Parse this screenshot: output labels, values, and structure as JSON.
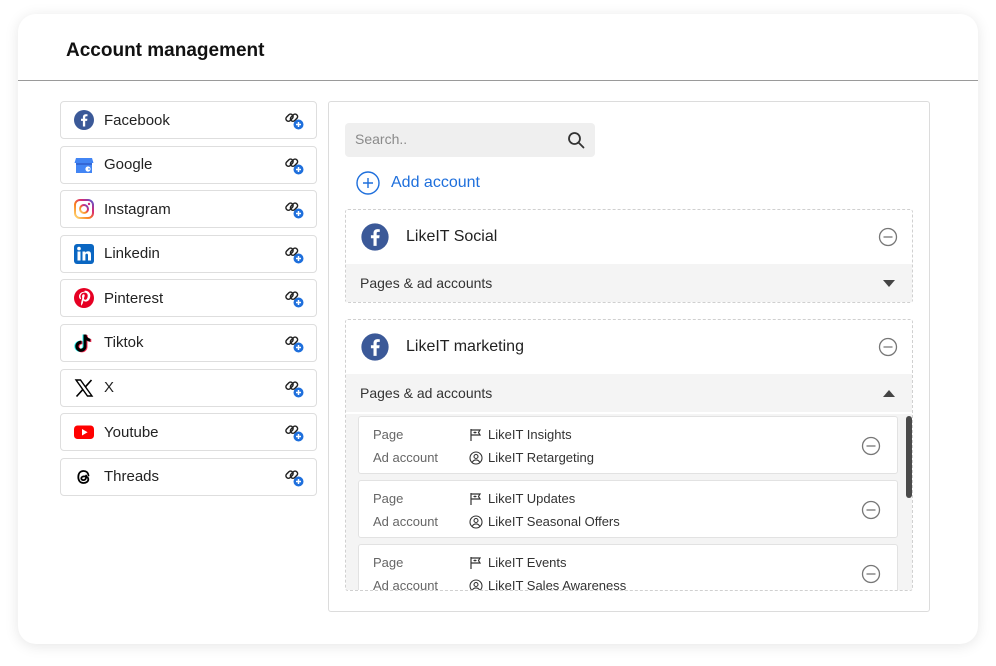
{
  "header": {
    "title": "Account management"
  },
  "platforms": [
    {
      "label": "Facebook",
      "icon": "facebook-icon",
      "color": "#3b5998"
    },
    {
      "label": "Google",
      "icon": "google-business-icon",
      "color": "#4285f4"
    },
    {
      "label": "Instagram",
      "icon": "instagram-icon",
      "color": "#e1306c"
    },
    {
      "label": "Linkedin",
      "icon": "linkedin-icon",
      "color": "#0a66c2"
    },
    {
      "label": "Pinterest",
      "icon": "pinterest-icon",
      "color": "#e60023"
    },
    {
      "label": "Tiktok",
      "icon": "tiktok-icon",
      "color": "#000000"
    },
    {
      "label": "X",
      "icon": "x-icon",
      "color": "#000000"
    },
    {
      "label": "Youtube",
      "icon": "youtube-icon",
      "color": "#ff0000"
    },
    {
      "label": "Threads",
      "icon": "threads-icon",
      "color": "#000000"
    }
  ],
  "search": {
    "placeholder": "Search.."
  },
  "add_account": {
    "label": "Add account",
    "color": "#1e6fdc"
  },
  "accounts": [
    {
      "name": "LikeIT Social",
      "section_label": "Pages & ad accounts",
      "expanded": false
    },
    {
      "name": "LikeIT marketing",
      "section_label": "Pages & ad accounts",
      "expanded": true,
      "items": [
        {
          "page_label": "Page",
          "page": "LikeIT Insights",
          "ad_label": "Ad account",
          "ad": "LikeIT Retargeting"
        },
        {
          "page_label": "Page",
          "page": "LikeIT Updates",
          "ad_label": "Ad account",
          "ad": "LikeIT Seasonal Offers"
        },
        {
          "page_label": "Page",
          "page": "LikeIT Events",
          "ad_label": "Ad account",
          "ad": "LikeIT Sales Awareness"
        }
      ]
    }
  ]
}
